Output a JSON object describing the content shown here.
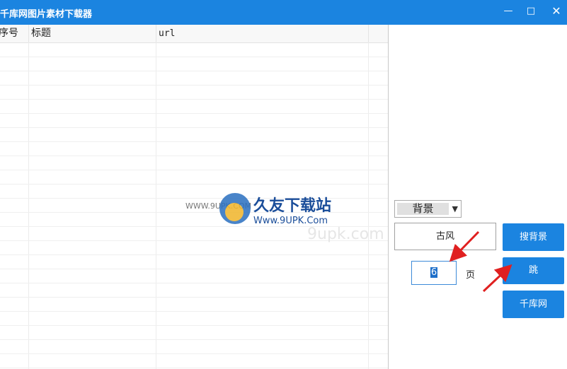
{
  "window": {
    "title": "千库网图片素材下载器",
    "min_glyph": "—",
    "max_glyph": "□",
    "close_glyph": "✕"
  },
  "table": {
    "columns": [
      "序号",
      "标题",
      "url"
    ]
  },
  "watermark": {
    "small": "WWW.9UPK.COM",
    "main": "久友下载站",
    "url": "Www.9UPK.Com",
    "ghost": "9upk.com"
  },
  "controls": {
    "category_select": "背景",
    "keyword_value": "古风",
    "page_value": "6",
    "page_unit": "页",
    "search_button": "搜背景",
    "jump_button": "跳",
    "qianku_button": "千库网"
  },
  "colors": {
    "accent": "#1b84e0",
    "arrow": "#e02020"
  }
}
